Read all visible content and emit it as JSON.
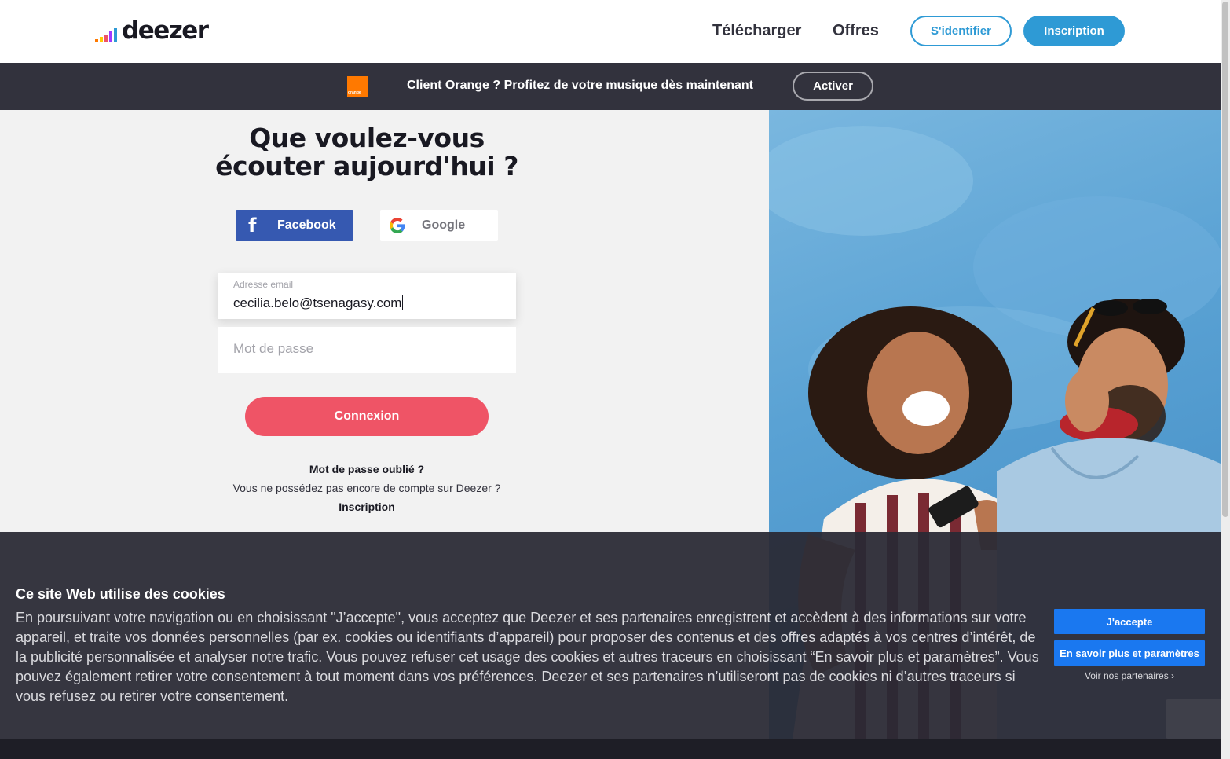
{
  "header": {
    "logo_text": "deezer",
    "logo_bar_colors": [
      "#ff7900",
      "#ffcc00",
      "#ef5466",
      "#a238ff",
      "#2e9ad5",
      "#191922"
    ],
    "nav": {
      "download": "Télécharger",
      "offers": "Offres"
    },
    "login_label": "S'identifier",
    "signup_label": "Inscription"
  },
  "banner": {
    "brand": "orange",
    "text": "Client Orange ? Profitez de votre musique dès maintenant",
    "button_label": "Activer"
  },
  "login": {
    "title_line1": "Que voulez-vous",
    "title_line2": "écouter aujourd'hui ?",
    "facebook_label": "Facebook",
    "google_label": "Google",
    "email": {
      "label": "Adresse email",
      "value": "cecilia.belo@tsenagasy.com"
    },
    "password": {
      "placeholder": "Mot de passe"
    },
    "submit_label": "Connexion",
    "forgot_label": "Mot de passe oublié ?",
    "no_account_text": "Vous ne possédez pas encore de compte sur Deezer ?",
    "signup_label": "Inscription"
  },
  "cookie": {
    "title": "Ce site Web utilise des cookies",
    "text": "En poursuivant votre navigation ou en choisissant \"J’accepte\", vous acceptez que Deezer et ses partenaires enregistrent et accèdent à des informations sur votre appareil, et traite vos données personnelles (par ex. cookies ou identifiants d’appareil) pour proposer des contenus et des offres adaptés à vos centres d’intérêt, de la publicité personnalisée et analyser notre trafic. Vous pouvez refuser cet usage des cookies et autres traceurs en choisissant “En savoir plus et paramètres”. Vous pouvez également retirer votre consentement à tout moment dans vos préférences. Deezer et ses partenaires n’utiliseront pas de cookies ni d’autres traceurs si vous refusez ou retirer votre consentement.",
    "accept_label": "J'accepte",
    "more_label": "En savoir plus et paramètres",
    "partners_label": "Voir nos partenaires ›"
  },
  "colors": {
    "accent_blue": "#2e9ad5",
    "connexion_pink": "#ef5466",
    "facebook_blue": "#3659b1",
    "cookie_button_blue": "#1a78f0",
    "dark": "#32323d"
  }
}
